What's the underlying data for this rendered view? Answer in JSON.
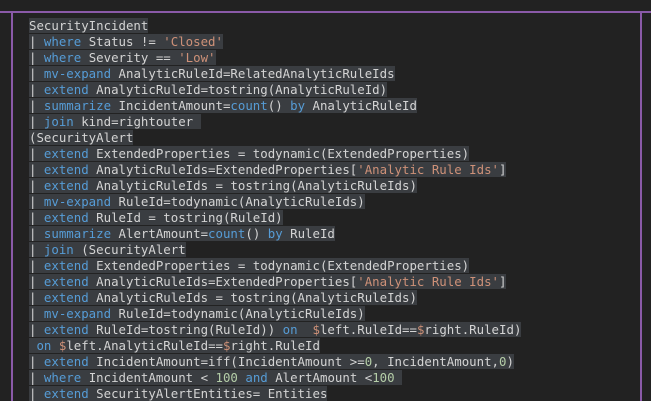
{
  "code_lines": [
    [
      {
        "t": "SecurityIncident",
        "c": "id"
      }
    ],
    [
      {
        "t": "| ",
        "c": "id"
      },
      {
        "t": "where",
        "c": "kw"
      },
      {
        "t": " Status != ",
        "c": "id"
      },
      {
        "t": "'Closed'",
        "c": "str"
      }
    ],
    [
      {
        "t": "| ",
        "c": "id"
      },
      {
        "t": "where",
        "c": "kw"
      },
      {
        "t": " Severity == ",
        "c": "id"
      },
      {
        "t": "'Low'",
        "c": "str"
      }
    ],
    [
      {
        "t": "| ",
        "c": "id"
      },
      {
        "t": "mv-expand",
        "c": "kw"
      },
      {
        "t": " AnalyticRuleId=RelatedAnalyticRuleIds",
        "c": "id"
      }
    ],
    [
      {
        "t": "| ",
        "c": "id"
      },
      {
        "t": "extend",
        "c": "kw"
      },
      {
        "t": " AnalyticRuleId=tostring(AnalyticRuleId)",
        "c": "id"
      }
    ],
    [
      {
        "t": "| ",
        "c": "id"
      },
      {
        "t": "summarize",
        "c": "kw"
      },
      {
        "t": " IncidentAmount=",
        "c": "id"
      },
      {
        "t": "count",
        "c": "kw"
      },
      {
        "t": "() ",
        "c": "id"
      },
      {
        "t": "by",
        "c": "kw"
      },
      {
        "t": " AnalyticRuleId",
        "c": "id"
      }
    ],
    [
      {
        "t": "| ",
        "c": "id"
      },
      {
        "t": "join",
        "c": "kw"
      },
      {
        "t": " kind=rightouter ",
        "c": "id"
      }
    ],
    [
      {
        "t": "(SecurityAlert",
        "c": "id"
      }
    ],
    [
      {
        "t": "| ",
        "c": "id"
      },
      {
        "t": "extend",
        "c": "kw"
      },
      {
        "t": " ExtendedProperties = todynamic(ExtendedProperties)",
        "c": "id"
      }
    ],
    [
      {
        "t": "| ",
        "c": "id"
      },
      {
        "t": "extend",
        "c": "kw"
      },
      {
        "t": " AnalyticRuleIds=ExtendedProperties[",
        "c": "id"
      },
      {
        "t": "'Analytic Rule Ids'",
        "c": "str"
      },
      {
        "t": "]",
        "c": "id"
      }
    ],
    [
      {
        "t": "| ",
        "c": "id"
      },
      {
        "t": "extend",
        "c": "kw"
      },
      {
        "t": " AnalyticRuleIds = tostring(AnalyticRuleIds)",
        "c": "id"
      }
    ],
    [
      {
        "t": "| ",
        "c": "id"
      },
      {
        "t": "mv-expand",
        "c": "kw"
      },
      {
        "t": " RuleId=todynamic(AnalyticRuleIds)",
        "c": "id"
      }
    ],
    [
      {
        "t": "| ",
        "c": "id"
      },
      {
        "t": "extend",
        "c": "kw"
      },
      {
        "t": " RuleId = tostring(RuleId)",
        "c": "id"
      }
    ],
    [
      {
        "t": "| ",
        "c": "id"
      },
      {
        "t": "summarize",
        "c": "kw"
      },
      {
        "t": " AlertAmount=",
        "c": "id"
      },
      {
        "t": "count",
        "c": "kw"
      },
      {
        "t": "() ",
        "c": "id"
      },
      {
        "t": "by",
        "c": "kw"
      },
      {
        "t": " RuleId",
        "c": "id"
      }
    ],
    [
      {
        "t": "| ",
        "c": "id"
      },
      {
        "t": "join",
        "c": "kw"
      },
      {
        "t": " (SecurityAlert",
        "c": "id"
      }
    ],
    [
      {
        "t": "| ",
        "c": "id"
      },
      {
        "t": "extend",
        "c": "kw"
      },
      {
        "t": " ExtendedProperties = todynamic(ExtendedProperties)",
        "c": "id"
      }
    ],
    [
      {
        "t": "| ",
        "c": "id"
      },
      {
        "t": "extend",
        "c": "kw"
      },
      {
        "t": " AnalyticRuleIds=ExtendedProperties[",
        "c": "id"
      },
      {
        "t": "'Analytic Rule Ids'",
        "c": "str"
      },
      {
        "t": "]",
        "c": "id"
      }
    ],
    [
      {
        "t": "| ",
        "c": "id"
      },
      {
        "t": "extend",
        "c": "kw"
      },
      {
        "t": " AnalyticRuleIds = tostring(AnalyticRuleIds)",
        "c": "id"
      }
    ],
    [
      {
        "t": "| ",
        "c": "id"
      },
      {
        "t": "mv-expand",
        "c": "kw"
      },
      {
        "t": " RuleId=todynamic(AnalyticRuleIds)",
        "c": "id"
      }
    ],
    [
      {
        "t": "| ",
        "c": "id"
      },
      {
        "t": "extend",
        "c": "kw"
      },
      {
        "t": " RuleId=tostring(RuleId)) ",
        "c": "id"
      },
      {
        "t": "on",
        "c": "kw"
      },
      {
        "t": "  ",
        "c": "id"
      },
      {
        "t": "$",
        "c": "str"
      },
      {
        "t": "left.RuleId==",
        "c": "id"
      },
      {
        "t": "$",
        "c": "str"
      },
      {
        "t": "right.RuleId)",
        "c": "id"
      }
    ],
    [
      {
        "t": " ",
        "c": "id"
      },
      {
        "t": "on",
        "c": "kw"
      },
      {
        "t": " ",
        "c": "id"
      },
      {
        "t": "$",
        "c": "str"
      },
      {
        "t": "left.AnalyticRuleId==",
        "c": "id"
      },
      {
        "t": "$",
        "c": "str"
      },
      {
        "t": "right.RuleId",
        "c": "id"
      }
    ],
    [
      {
        "t": "| ",
        "c": "id"
      },
      {
        "t": "extend",
        "c": "kw"
      },
      {
        "t": " IncidentAmount=iff(IncidentAmount >=",
        "c": "id"
      },
      {
        "t": "0",
        "c": "num"
      },
      {
        "t": ", IncidentAmount,",
        "c": "id"
      },
      {
        "t": "0",
        "c": "num"
      },
      {
        "t": ")",
        "c": "id"
      }
    ],
    [
      {
        "t": "| ",
        "c": "id"
      },
      {
        "t": "where",
        "c": "kw"
      },
      {
        "t": " IncidentAmount < ",
        "c": "id"
      },
      {
        "t": "100",
        "c": "num"
      },
      {
        "t": " ",
        "c": "id"
      },
      {
        "t": "and",
        "c": "kw"
      },
      {
        "t": " AlertAmount <",
        "c": "id"
      },
      {
        "t": "100",
        "c": "num"
      },
      {
        "t": " ",
        "c": "id"
      }
    ],
    [
      {
        "t": "| ",
        "c": "id"
      },
      {
        "t": "extend",
        "c": "kw"
      },
      {
        "t": " SecurityAlertEntities= Entities",
        "c": "id"
      }
    ]
  ],
  "colors": {
    "keyword": "#569cd6",
    "string": "#ce9178",
    "number": "#b5cea8",
    "text": "#d4d4d4",
    "selection": "#3a3d41",
    "border": "#8a5aa8"
  }
}
